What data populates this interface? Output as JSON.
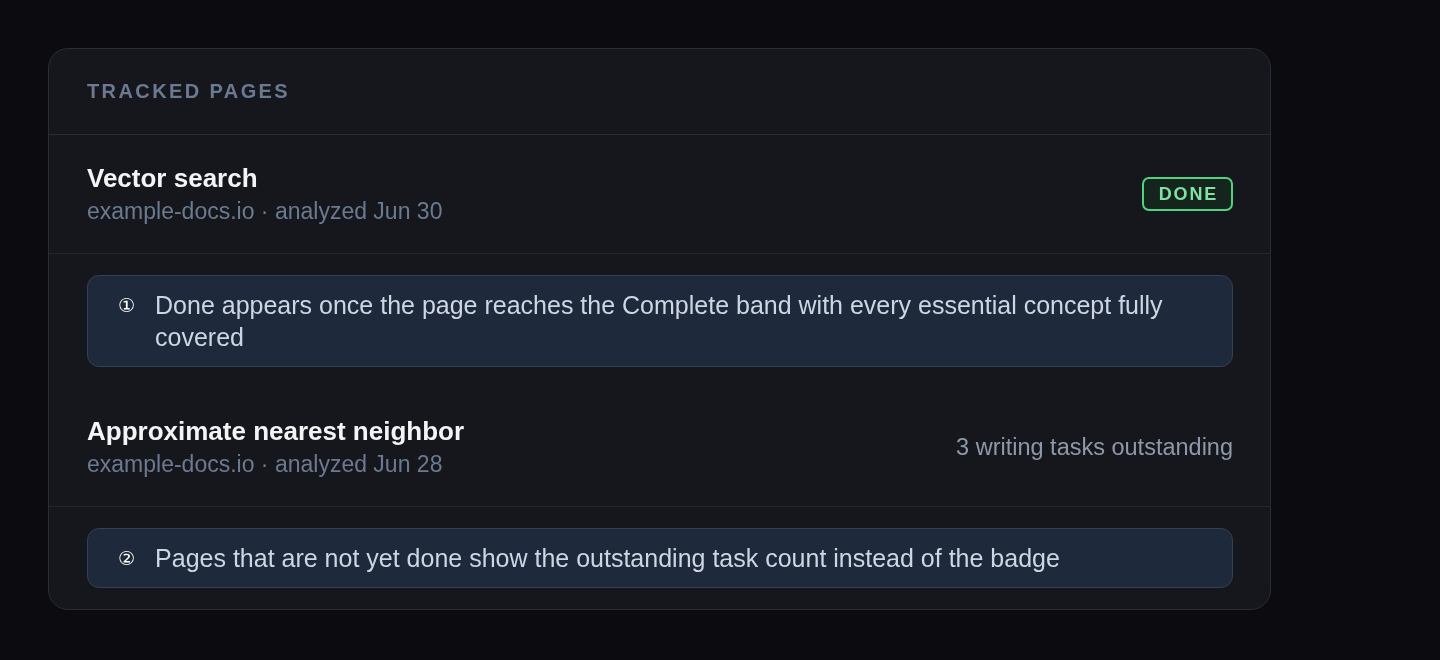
{
  "card": {
    "title": "TRACKED PAGES"
  },
  "pages": [
    {
      "title": "Vector search",
      "meta": "example-docs.io · analyzed Jun 30",
      "status": {
        "kind": "badge",
        "text": "DONE"
      },
      "note": {
        "marker": "①",
        "text": "Done appears once the page reaches the Complete band with every essential concept fully covered"
      }
    },
    {
      "title": "Approximate nearest neighbor",
      "meta": "example-docs.io · analyzed Jun 28",
      "status": {
        "kind": "count",
        "text": "3 writing tasks outstanding"
      },
      "note": {
        "marker": "②",
        "text": "Pages that are not yet done show the outstanding task count instead of the badge"
      }
    }
  ]
}
